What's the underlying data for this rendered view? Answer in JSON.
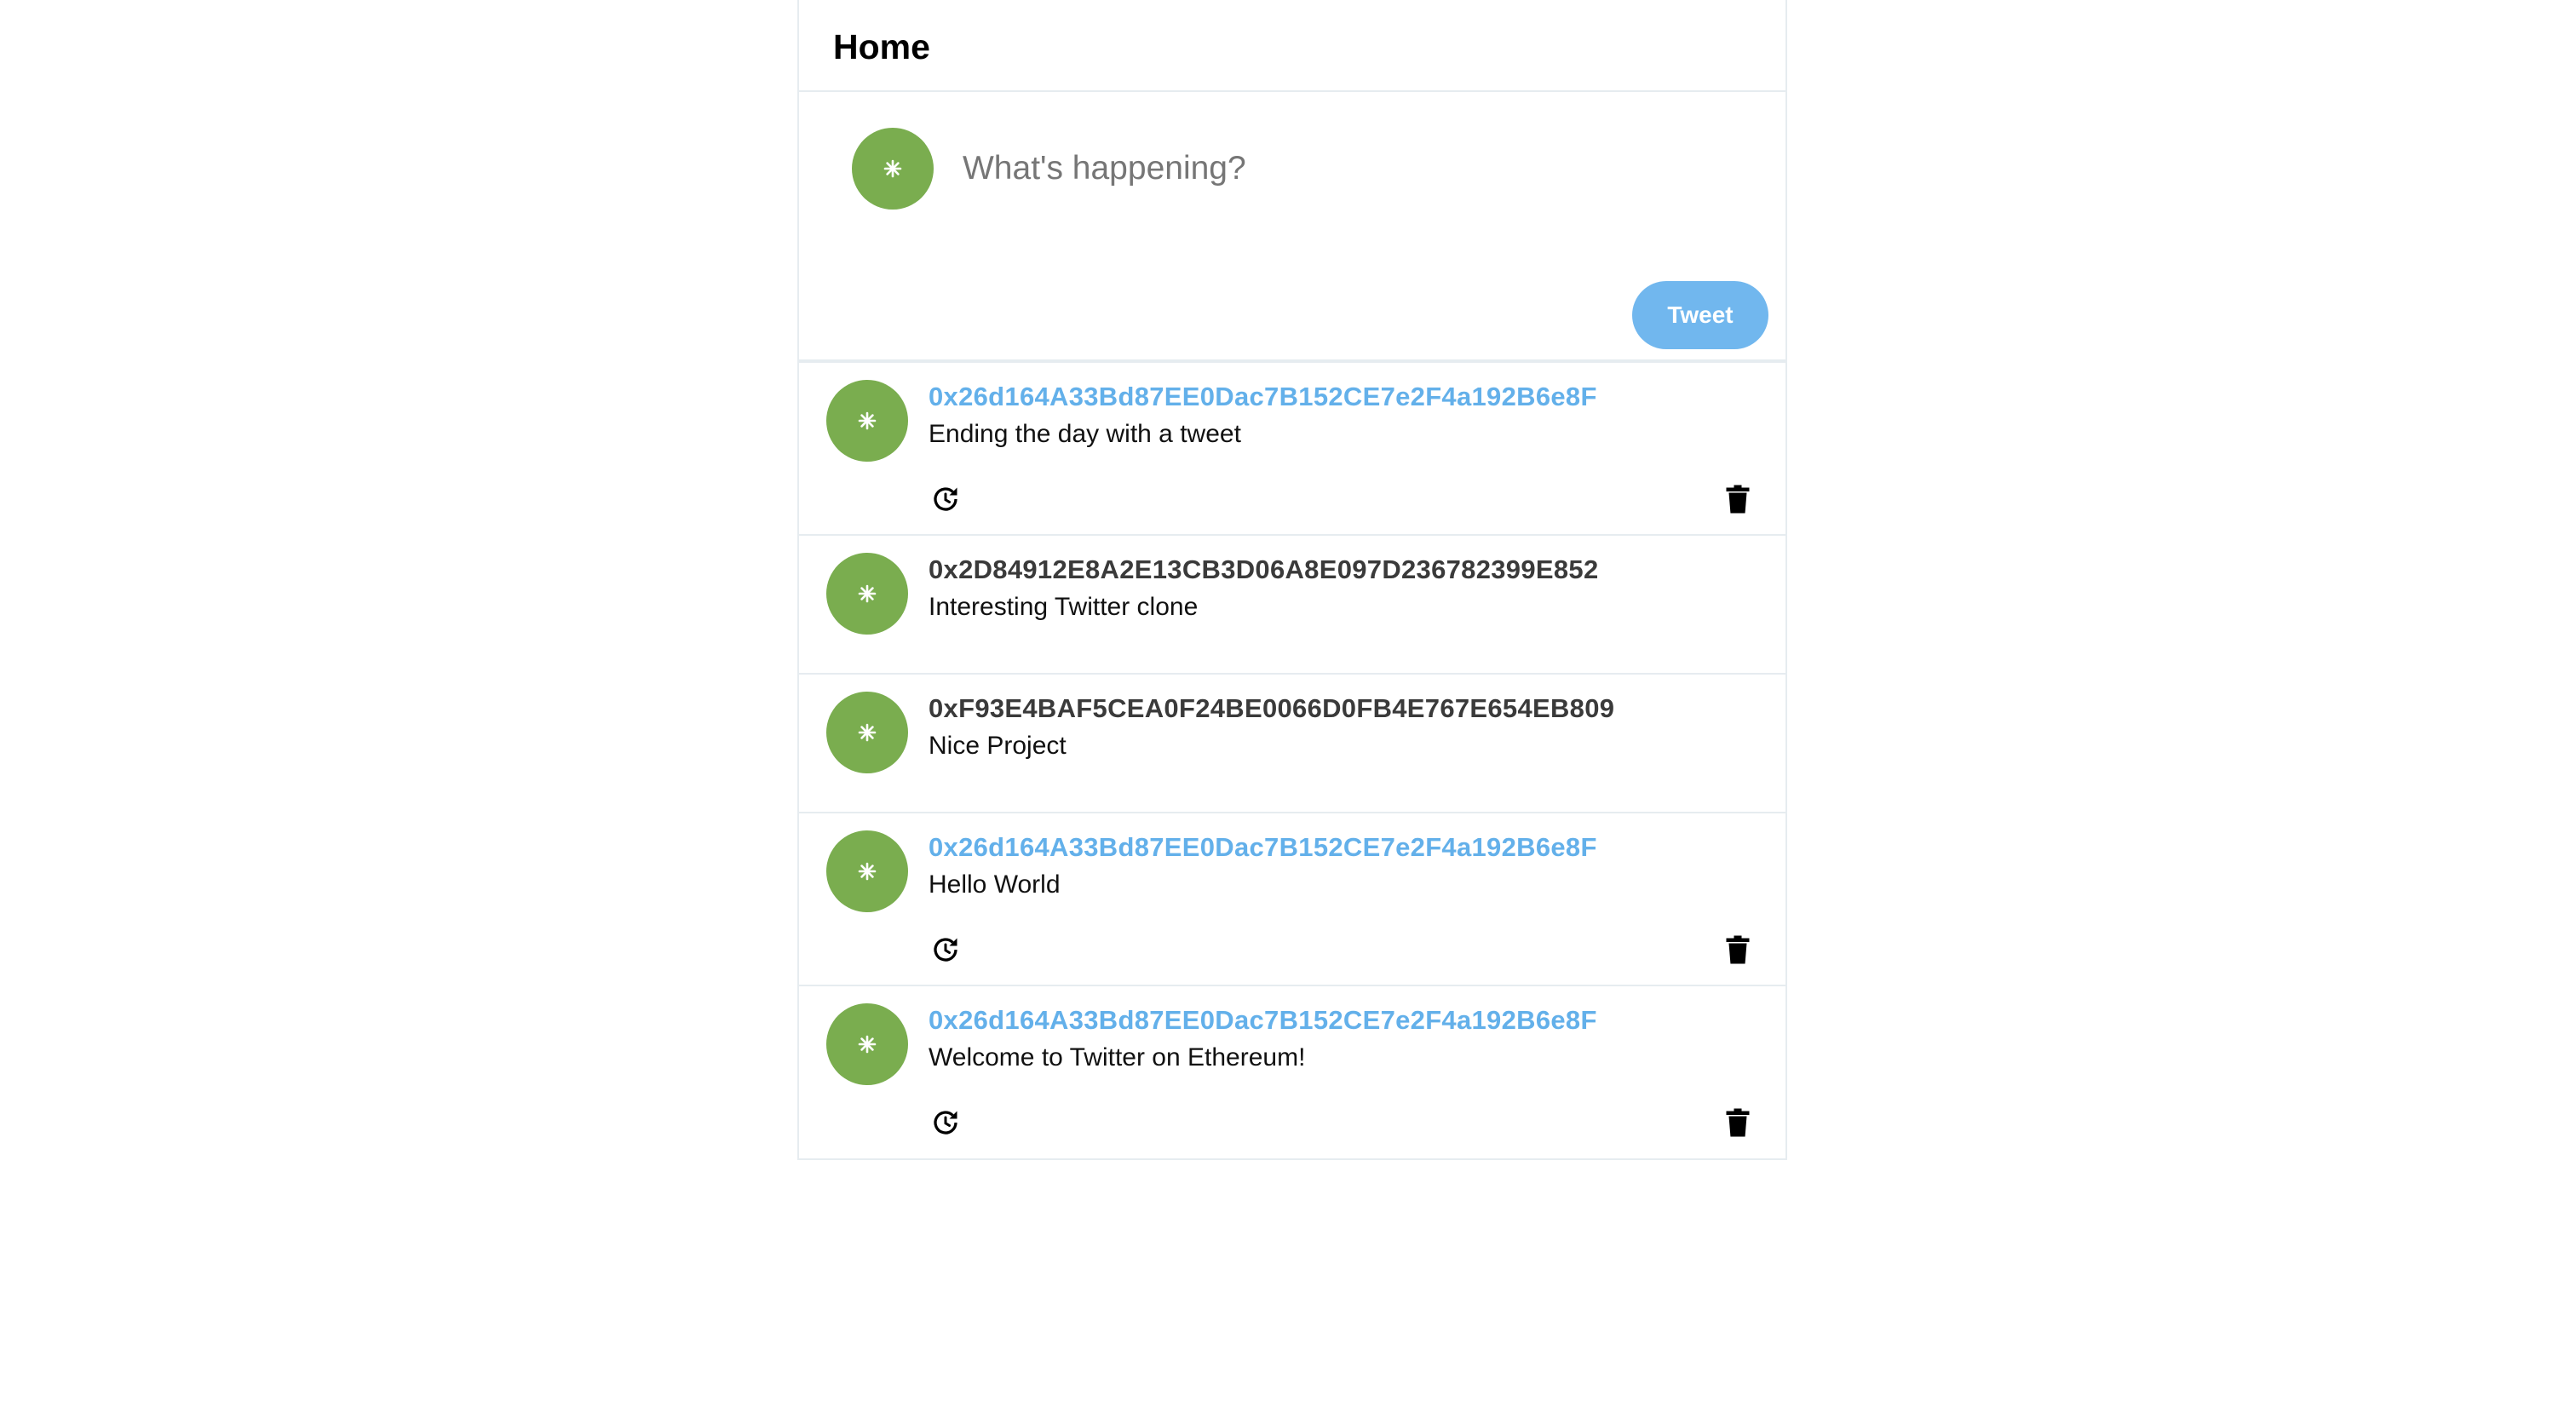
{
  "header": {
    "title": "Home"
  },
  "compose": {
    "placeholder": "What's happening?",
    "value": "",
    "button_label": "Tweet"
  },
  "colors": {
    "avatar": "#7aad4f",
    "own_address": "#63b0ea",
    "tweet_button": "#71b7ee",
    "border": "#e6ecf0"
  },
  "tweets": [
    {
      "author": "0x26d164A33Bd87EE0Dac7B152CE7e2F4a192B6e8F",
      "text": "Ending the day with a tweet",
      "own": true
    },
    {
      "author": "0x2D84912E8A2E13CB3D06A8E097D236782399E852",
      "text": "Interesting Twitter clone",
      "own": false
    },
    {
      "author": "0xF93E4BAF5CEA0F24BE0066D0FB4E767E654EB809",
      "text": "Nice Project",
      "own": false
    },
    {
      "author": "0x26d164A33Bd87EE0Dac7B152CE7e2F4a192B6e8F",
      "text": "Hello World",
      "own": true
    },
    {
      "author": "0x26d164A33Bd87EE0Dac7B152CE7e2F4a192B6e8F",
      "text": "Welcome to Twitter on Ethereum!",
      "own": true
    }
  ],
  "icons": {
    "avatar": "star-icon",
    "update": "refresh-icon",
    "delete": "trash-icon"
  }
}
